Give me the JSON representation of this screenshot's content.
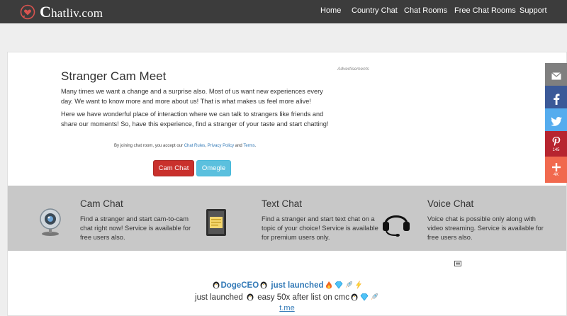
{
  "navbar": {
    "logo_text": "hatliv.com",
    "logo_letter": "C",
    "items": [
      "Home",
      "Country Chat",
      "Chat Rooms",
      "Free Chat Rooms",
      "Support"
    ]
  },
  "main": {
    "title": "Stranger Cam Meet",
    "para1": "Many times we want a change and a surprise also. Most of us want new experiences every day. We want to know more and more about us! That is what makes us feel more alive!",
    "para2": "Here we have wonderful place of interaction where we can talk to strangers like friends and share our moments! So, have this experience, find a stranger of your taste and start chatting!",
    "disclaimer_prefix": "By joining chat room, you accept our ",
    "chat_rules": "Chat Rules",
    "sep": ", ",
    "privacy_policy": "Privacy Policy",
    "and": " and ",
    "terms": "Terms",
    "period": ".",
    "advertisements": "Advertisements",
    "cam_chat_button": "Cam Chat",
    "omegle_button": "Omegle"
  },
  "features": [
    {
      "title": "Cam Chat",
      "desc": "Find a stranger and start cam-to-cam chat right now! Service is available for free users also.",
      "icon": "webcam-icon"
    },
    {
      "title": "Text Chat",
      "desc": "Find a stranger and start text chat on a topic of your choice! Service is available for premium users only.",
      "icon": "notepad-icon"
    },
    {
      "title": "Voice Chat",
      "desc": "Voice chat is possible only along with video streaming. Service is available for free users also.",
      "icon": "headset-icon"
    }
  ],
  "promo": {
    "line1_name": "DogeCEO",
    "line1_rest": "just launched",
    "line2_a": "just launched",
    "line2_b": "easy 50x after list on cmc",
    "link": "t.me"
  },
  "share": {
    "pinterest_count": "145",
    "more_count": "4K"
  },
  "colors": {
    "navbar": "#3c3c3c",
    "cam_button": "#c9302c",
    "omegle_button": "#5bc0de",
    "band": "#c8c8c8",
    "link": "#337ab7"
  }
}
